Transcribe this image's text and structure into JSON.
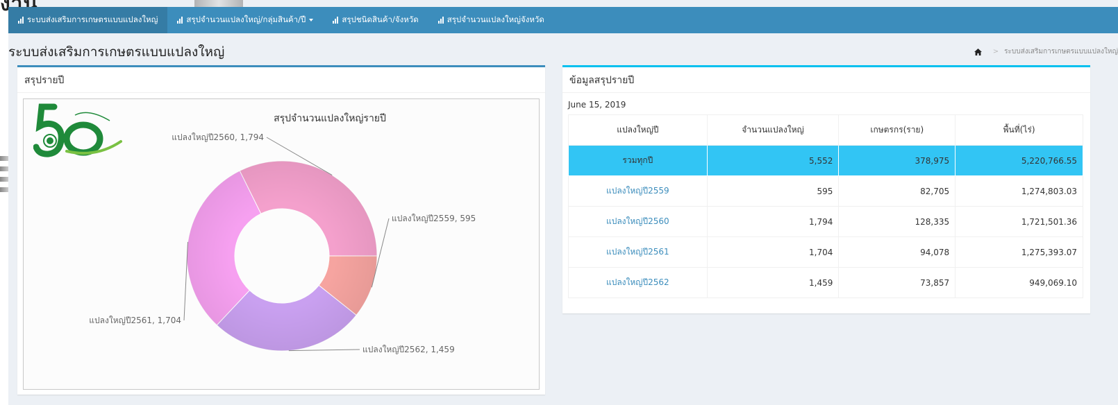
{
  "overlay": {
    "text": "งาน"
  },
  "navbar": {
    "items": [
      {
        "label": "ระบบส่งเสริมการเกษตรแบบแปลงใหญ่",
        "active": true,
        "dropdown": false
      },
      {
        "label": "สรุปจำนวนแปลงใหญ่/กลุ่มสินค้า/ปี",
        "active": false,
        "dropdown": true
      },
      {
        "label": "สรุปชนิดสินค้า/จังหวัด",
        "active": false,
        "dropdown": false
      },
      {
        "label": "สรุปจำนวนแปลงใหญ่จังหวัด",
        "active": false,
        "dropdown": false
      }
    ]
  },
  "page": {
    "title": "ระบบส่งเสริมการเกษตรแบบแปลงใหญ่"
  },
  "breadcrumb": {
    "home_icon": "home-icon",
    "current": "ระบบส่งเสริมการเกษตรแบบแปลงใหญ่"
  },
  "left_box": {
    "title": "สรุปรายปี"
  },
  "right_box": {
    "title": "ข้อมูลสรุปรายปี",
    "date": "June 15, 2019"
  },
  "colors": {
    "navbar": "#3c8dbc",
    "total_row": "#32c5f4",
    "link": "#3c8dbc"
  },
  "chart_data": {
    "type": "pie",
    "donut": true,
    "title": "สรุปจำนวนแปลงใหญ่รายปี",
    "slices": [
      {
        "label": "แปลงใหญ่ปี2559",
        "value": 595,
        "label_text": "แปลงใหญ่ปี2559, 595",
        "color": "#f6a4a0"
      },
      {
        "label": "แปลงใหญ่ปี2562",
        "value": 1459,
        "label_text": "แปลงใหญ่ปี2562, 1,459",
        "color": "#c9a0f0"
      },
      {
        "label": "แปลงใหญ่ปี2561",
        "value": 1704,
        "label_text": "แปลงใหญ่ปี2561, 1,704",
        "color": "#f6a0f0"
      },
      {
        "label": "แปลงใหญ่ปี2560",
        "value": 1794,
        "label_text": "แปลงใหญ่ปี2560, 1,794",
        "color": "#f4a0cc"
      }
    ]
  },
  "table": {
    "headers": [
      "แปลงใหญ่ปี",
      "จำนวนแปลงใหญ่",
      "เกษตรกร(ราย)",
      "พื้นที่(ไร่)"
    ],
    "total": {
      "name": "รวมทุกปี",
      "plots": "5,552",
      "farmers": "378,975",
      "area": "5,220,766.55"
    },
    "rows": [
      {
        "name": "แปลงใหญ่ปี2559",
        "plots": "595",
        "farmers": "82,705",
        "area": "1,274,803.03"
      },
      {
        "name": "แปลงใหญ่ปี2560",
        "plots": "1,794",
        "farmers": "128,335",
        "area": "1,721,501.36"
      },
      {
        "name": "แปลงใหญ่ปี2561",
        "plots": "1,704",
        "farmers": "94,078",
        "area": "1,275,393.07"
      },
      {
        "name": "แปลงใหญ่ปี2562",
        "plots": "1,459",
        "farmers": "73,857",
        "area": "949,069.10"
      }
    ]
  }
}
